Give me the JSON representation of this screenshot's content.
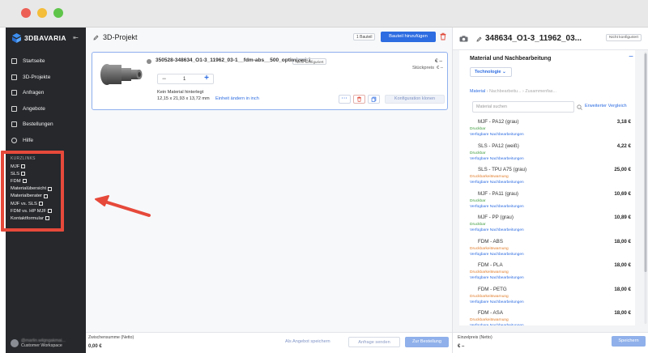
{
  "sidebar": {
    "brand": "3DBAVARIA",
    "nav": [
      {
        "label": "Startseite",
        "icon": "home-icon"
      },
      {
        "label": "3D-Projekte",
        "icon": "folder-icon"
      },
      {
        "label": "Anfragen",
        "icon": "inbox-icon"
      },
      {
        "label": "Angebote",
        "icon": "document-icon"
      },
      {
        "label": "Bestellungen",
        "icon": "cart-icon"
      },
      {
        "label": "Hilfe",
        "icon": "help-icon"
      }
    ],
    "shortlinks_title": "KURZLINKS",
    "shortlinks": [
      "MJF",
      "SLS",
      "FDM",
      "Materialübersicht",
      "Materialberater",
      "MJF vs. SLS",
      "FDM vs. HP MJF",
      "Kontaktformular"
    ],
    "user": {
      "name": "@marlin.wilgngakmai...",
      "workspace": "Customer Workspace"
    }
  },
  "main": {
    "title": "3D-Projekt",
    "parts_badge": "1 Bauteil",
    "add_part": "Bauteil hinzufügen",
    "part": {
      "name": "350528-348634_O1-3_11962_03-1__fdm-abs__500_optimized-1",
      "status": "Nicht konfiguriert",
      "price": "€ –",
      "unit_price_label": "Stückpreis",
      "unit_price_value": "€ –",
      "quantity": "1",
      "qty_minus": "−",
      "qty_plus": "+",
      "no_material": "Kein Material hinterlegt",
      "dimensions": "12,15 x 21,93 x 13,72 mm",
      "unit_link": "Einheit ändern in inch",
      "more": "···",
      "clone": "Konfiguration klonen"
    },
    "footer": {
      "subtotal_label": "Zwischensumme (Netto)",
      "subtotal_value": "0,00 €",
      "save_quote": "Als Angebot speichern",
      "send_request": "Anfrage senden",
      "checkout": "Zur Bestellung"
    }
  },
  "panel": {
    "title": "348634_O1-3_11962_03...",
    "status": "Nicht konfiguriert",
    "section_title": "Material und Nachbearbeitung",
    "collapse": "−",
    "tab": "Technologie",
    "crumbs": [
      "Material",
      "Nachbearbeitu...",
      "Zusammenfas..."
    ],
    "search_placeholder": "Material suchen",
    "compare": "Erweiterter Vergleich",
    "post_link": "Verfügbare Nachbearbeitungen",
    "materials": [
      {
        "name": "MJF - PA12 (grau)",
        "price": "3,18 €",
        "status": "Druckbar",
        "warn": false
      },
      {
        "name": "SLS - PA12 (weiß)",
        "price": "4,22 €",
        "status": "Druckbar",
        "warn": false
      },
      {
        "name": "SLS - TPU A75 (grau)",
        "price": "25,00 €",
        "status": "Druckbarkeitswarnung",
        "warn": true
      },
      {
        "name": "MJF - PA11 (grau)",
        "price": "10,69 €",
        "status": "Druckbar",
        "warn": false
      },
      {
        "name": "MJF - PP (grau)",
        "price": "10,89 €",
        "status": "Druckbar",
        "warn": false
      },
      {
        "name": "FDM - ABS",
        "price": "18,00 €",
        "status": "Druckbarkeitswarnung",
        "warn": true
      },
      {
        "name": "FDM - PLA",
        "price": "18,00 €",
        "status": "Druckbarkeitswarnung",
        "warn": true
      },
      {
        "name": "FDM - PETG",
        "price": "18,00 €",
        "status": "Druckbarkeitswarnung",
        "warn": true
      },
      {
        "name": "FDM - ASA",
        "price": "18,00 €",
        "status": "Druckbarkeitswarnung",
        "warn": true
      }
    ],
    "footer": {
      "unit_price_label": "Einzelpreis (Netto)",
      "unit_price_value": "€ –",
      "save": "Speichern"
    }
  },
  "colors": {
    "accent": "#2d6ce1",
    "ok": "#3a9a3a",
    "warn": "#e07b28",
    "highlight": "#e6493a"
  }
}
